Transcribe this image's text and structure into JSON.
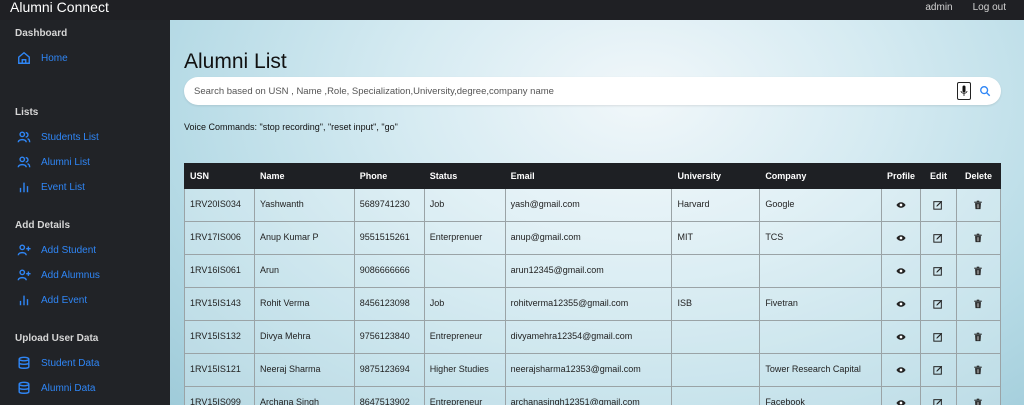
{
  "app": {
    "title": "Alumni Connect"
  },
  "topnav": {
    "admin": "admin",
    "logout": "Log out"
  },
  "sidebar": {
    "dashboard": {
      "title": "Dashboard",
      "items": [
        {
          "label": "Home",
          "icon": "home-icon"
        }
      ]
    },
    "lists": {
      "title": "Lists",
      "items": [
        {
          "label": "Students List",
          "icon": "users-icon"
        },
        {
          "label": "Alumni List",
          "icon": "users-icon"
        },
        {
          "label": "Event List",
          "icon": "bar-chart-icon"
        }
      ]
    },
    "add": {
      "title": "Add Details",
      "items": [
        {
          "label": "Add Student",
          "icon": "user-plus-icon"
        },
        {
          "label": "Add Alumnus",
          "icon": "user-plus-icon"
        },
        {
          "label": "Add Event",
          "icon": "bar-chart-icon"
        }
      ]
    },
    "upload": {
      "title": "Upload User Data",
      "items": [
        {
          "label": "Student Data",
          "icon": "database-icon"
        },
        {
          "label": "Alumni Data",
          "icon": "database-icon"
        }
      ]
    }
  },
  "main": {
    "title": "Alumni List",
    "search_placeholder": "Search based on USN , Name ,Role, Specialization,University,degree,company name",
    "search_value": "",
    "voice_commands": "Voice Commands: \"stop recording\", \"reset input\", \"go\""
  },
  "table": {
    "headers": [
      "USN",
      "Name",
      "Phone",
      "Status",
      "Email",
      "University",
      "Company",
      "Profile",
      "Edit",
      "Delete"
    ],
    "rows": [
      {
        "usn": "1RV20IS034",
        "name": "Yashwanth",
        "phone": "5689741230",
        "status": "Job",
        "email": "yash@gmail.com",
        "university": "Harvard",
        "company": "Google"
      },
      {
        "usn": "1RV17IS006",
        "name": "Anup Kumar P",
        "phone": "9551515261",
        "status": "Enterprenuer",
        "email": "anup@gmail.com",
        "university": "MIT",
        "company": "TCS"
      },
      {
        "usn": "1RV16IS061",
        "name": "Arun",
        "phone": "9086666666",
        "status": "",
        "email": "arun12345@gmail.com",
        "university": "",
        "company": ""
      },
      {
        "usn": "1RV15IS143",
        "name": "Rohit Verma",
        "phone": "8456123098",
        "status": "Job",
        "email": "rohitverma12355@gmail.com",
        "university": "ISB",
        "company": "Fivetran"
      },
      {
        "usn": "1RV15IS132",
        "name": "Divya Mehra",
        "phone": "9756123840",
        "status": "Entrepreneur",
        "email": "divyamehra12354@gmail.com",
        "university": "",
        "company": ""
      },
      {
        "usn": "1RV15IS121",
        "name": "Neeraj Sharma",
        "phone": "9875123694",
        "status": "Higher Studies",
        "email": "neerajsharma12353@gmail.com",
        "university": "",
        "company": "Tower Research Capital"
      },
      {
        "usn": "1RV15IS099",
        "name": "Archana Singh",
        "phone": "8647513902",
        "status": "Entrepreneur",
        "email": "archanasingh12351@gmail.com",
        "university": "",
        "company": "Facebook"
      }
    ]
  },
  "colors": {
    "accent": "#2f86f6",
    "sidebar_bg": "#212327",
    "table_header_bg": "#1e2024"
  }
}
